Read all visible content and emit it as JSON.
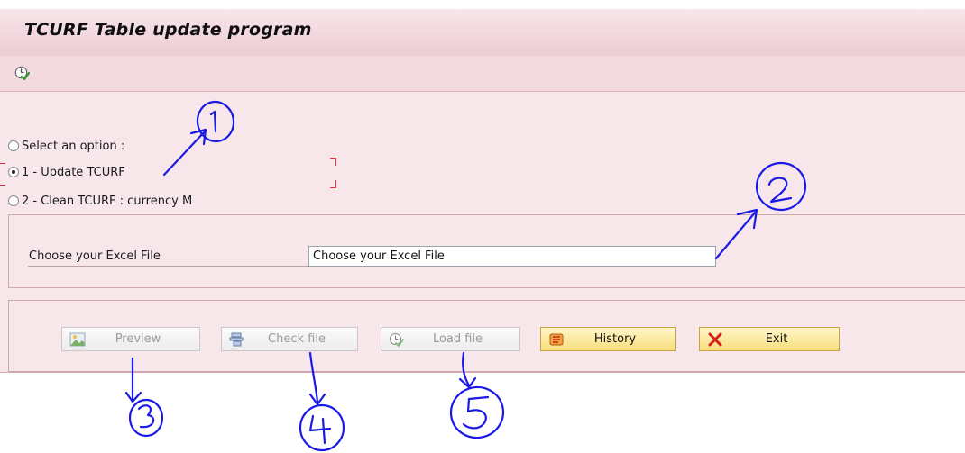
{
  "window": {
    "title": "TCURF Table update program"
  },
  "toolbar": {
    "execute_icon": "execute-clock-check-icon"
  },
  "options": {
    "items": [
      {
        "label": "Select an option :",
        "checked": false
      },
      {
        "label": "1 - Update TCURF",
        "checked": true
      },
      {
        "label": "2 - Clean TCURF : currency M",
        "checked": false
      }
    ]
  },
  "file": {
    "label": "Choose your Excel File",
    "value": "Choose your Excel File"
  },
  "buttons": {
    "preview": {
      "label": "Preview",
      "icon": "preview-image-icon",
      "enabled": false
    },
    "check_file": {
      "label": "Check file",
      "icon": "check-file-icon",
      "enabled": false
    },
    "load_file": {
      "label": "Load file",
      "icon": "load-execute-icon",
      "enabled": false
    },
    "history": {
      "label": "History",
      "icon": "history-scroll-icon",
      "enabled": true
    },
    "exit": {
      "label": "Exit",
      "icon": "exit-x-icon",
      "enabled": true
    }
  },
  "annotations": {
    "marks": [
      "1",
      "2",
      "3",
      "4",
      "5"
    ],
    "color": "#1a1ae6"
  },
  "colors": {
    "panel": "#f7e6ea",
    "title_bar": "#edccd4",
    "highlight_button": "#f7de7c",
    "bracket": "#e0303a"
  }
}
